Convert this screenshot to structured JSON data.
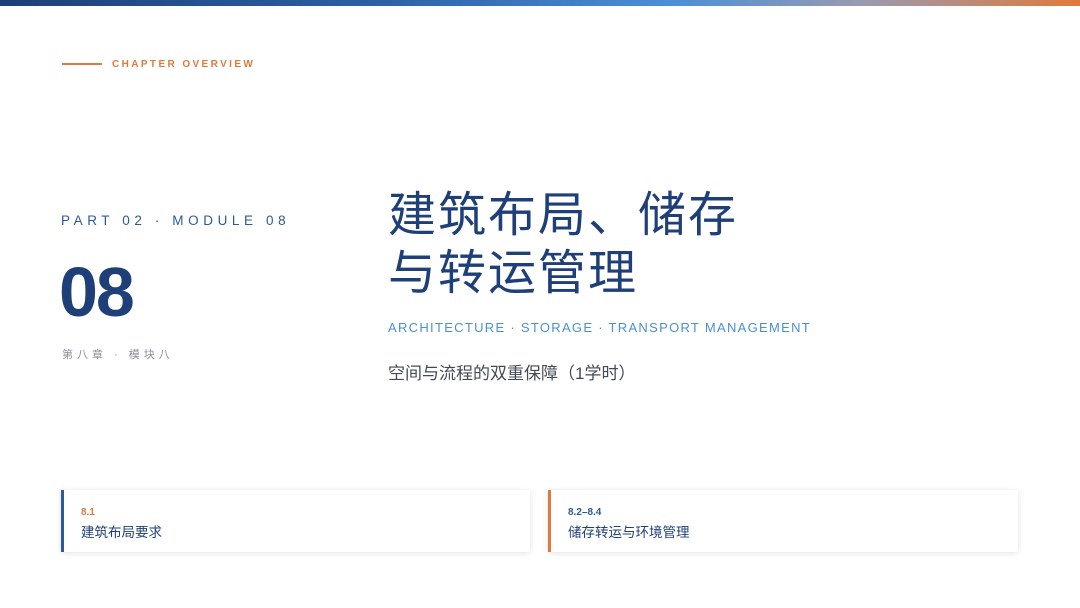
{
  "header": {
    "overview_label": "CHAPTER OVERVIEW"
  },
  "left": {
    "part_label": "PART 02 · MODULE 08",
    "number": "08",
    "chapter_cn": "第八章 · 模块八"
  },
  "title": {
    "line1": "建筑布局、储存",
    "line2": "与转运管理",
    "en_subtitle": "ARCHITECTURE · STORAGE · TRANSPORT MANAGEMENT",
    "cn_subtitle": "空间与流程的双重保障（1学时）"
  },
  "cards": [
    {
      "code": "8.1",
      "title": "建筑布局要求"
    },
    {
      "code": "8.2–8.4",
      "title": "储存转运与环境管理"
    }
  ],
  "colors": {
    "navy": "#1e3f78",
    "blue": "#2d5a9a",
    "light_blue": "#4a90d4",
    "orange": "#e07a3c",
    "gray": "#8a8f99"
  }
}
